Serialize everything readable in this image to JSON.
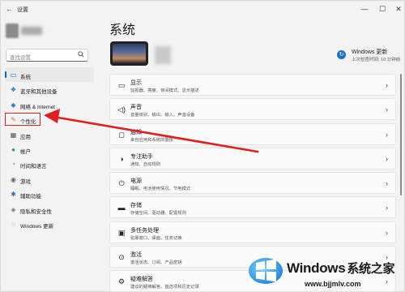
{
  "window": {
    "title": "设置",
    "back_glyph": "←",
    "min_glyph": "—",
    "max_glyph": "☐",
    "close_glyph": "✕"
  },
  "search": {
    "placeholder": "查找设置",
    "icon": "search-icon"
  },
  "sidebar": {
    "items": [
      {
        "label": "系统",
        "icon": "▭",
        "icon_color": "#0067c0",
        "active": true
      },
      {
        "label": "蓝牙和其他设备",
        "icon": "❖",
        "icon_color": "#0a72c7"
      },
      {
        "label": "网络 & Internet",
        "icon": "◆",
        "icon_color": "#3a7bd5"
      },
      {
        "label": "个性化",
        "icon": "✎",
        "icon_color": "#d47f29",
        "highlight": true
      },
      {
        "label": "应用",
        "icon": "▦",
        "icon_color": "#555555"
      },
      {
        "label": "帐户",
        "icon": "●",
        "icon_color": "#23a363"
      },
      {
        "label": "时间和语言",
        "icon": "◔",
        "icon_color": "#3580c9"
      },
      {
        "label": "游戏",
        "icon": "◉",
        "icon_color": "#666666"
      },
      {
        "label": "辅助功能",
        "icon": "✱",
        "icon_color": "#2f6fb3"
      },
      {
        "label": "隐私和安全性",
        "icon": "◈",
        "icon_color": "#777777"
      },
      {
        "label": "Windows 更新",
        "icon": "◌",
        "icon_color": "#1a73c7"
      }
    ]
  },
  "main": {
    "title": "系统",
    "update": {
      "title": "Windows 更新",
      "subtitle": "上次检查时间: 10 分钟前",
      "icon_glyph": "↻"
    },
    "cards": [
      {
        "icon": "▭",
        "title": "显示",
        "subtitle": "监视器、亮度、夜间模式、显示描述"
      },
      {
        "icon": "◁)",
        "title": "声音",
        "subtitle": "音量级别、输出、输入、声音设备"
      },
      {
        "icon": "◻",
        "title": "通知",
        "subtitle": "来自应用和系统的警报"
      },
      {
        "icon": "◑",
        "title": "专注助手",
        "subtitle": "通知、自动规则"
      },
      {
        "icon": "⏻",
        "title": "电源",
        "subtitle": "睡眠、电池使用情况、节电模式"
      },
      {
        "icon": "▬",
        "title": "存储",
        "subtitle": "存储空间、驱动器、配置规则"
      },
      {
        "icon": "▣",
        "title": "多任务处理",
        "subtitle": "贴靠窗口、桌面、任务切换"
      },
      {
        "icon": "⊙",
        "title": "激活",
        "subtitle": "激活状态、订阅、产品密钥"
      },
      {
        "icon": "⚙",
        "title": "疑难解答",
        "subtitle": "建议的疑难解答、首选项和历史记录"
      }
    ],
    "chevron": "›"
  },
  "watermark": {
    "brand": "Windows",
    "brand_cn": "系统之家",
    "url": "www.bjjmlv.com"
  },
  "colors": {
    "accent": "#0067c0",
    "annotation": "#e02020"
  }
}
